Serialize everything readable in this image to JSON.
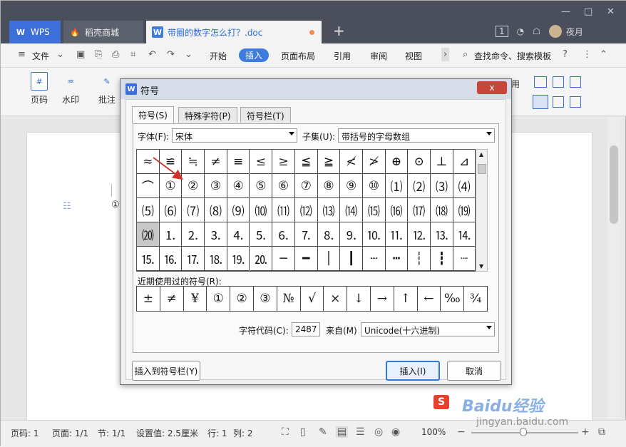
{
  "titlebar": {
    "tabs": [
      {
        "label": "WPS",
        "icon": "W"
      },
      {
        "label": "稻壳商城",
        "icon": "shell-icon"
      },
      {
        "label": "带圈的数字怎么打？.doc",
        "icon": "W"
      }
    ],
    "page_badge": "1",
    "user_name": "夜月"
  },
  "menubar": {
    "file_label": "文件",
    "items": [
      "开始",
      "插入",
      "页面布局",
      "引用",
      "审阅",
      "视图"
    ],
    "active_item": "插入",
    "search_label": "查找命令、搜索模板",
    "help_label": "?"
  },
  "ribbon": {
    "buttons": [
      "页码",
      "水印",
      "批注"
    ],
    "right_label": "用"
  },
  "dialog": {
    "title": "符号",
    "close_label": "x",
    "tabs": [
      "符号(S)",
      "特殊字符(P)",
      "符号栏(T)"
    ],
    "font_label": "字体(F):",
    "font_value": "宋体",
    "subset_label": "子集(U):",
    "subset_value": "带括号的字母数组",
    "symbols": [
      [
        "≈",
        "≌",
        "≒",
        "≠",
        "≡",
        "≤",
        "≥",
        "≦",
        "≧",
        "≮",
        "≯",
        "⊕",
        "⊙",
        "⊥",
        "⊿"
      ],
      [
        "⌒",
        "①",
        "②",
        "③",
        "④",
        "⑤",
        "⑥",
        "⑦",
        "⑧",
        "⑨",
        "⑩",
        "⑴",
        "⑵",
        "⑶",
        "⑷"
      ],
      [
        "⑸",
        "⑹",
        "⑺",
        "⑻",
        "⑼",
        "⑽",
        "⑾",
        "⑿",
        "⒀",
        "⒁",
        "⒂",
        "⒃",
        "⒄",
        "⒅",
        "⒆"
      ],
      [
        "⒇",
        "⒈",
        "⒉",
        "⒊",
        "⒋",
        "⒌",
        "⒍",
        "⒎",
        "⒏",
        "⒐",
        "⒑",
        "⒒",
        "⒓",
        "⒔",
        "⒕"
      ],
      [
        "⒖",
        "⒗",
        "⒘",
        "⒙",
        "⒚",
        "⒛",
        "─",
        "━",
        "│",
        "┃",
        "┄",
        "┅",
        "┆",
        "┇",
        "┈"
      ]
    ],
    "highlighted_symbol": "⒇",
    "recent_label": "近期使用过的符号(R):",
    "recent_symbols": [
      "±",
      "≠",
      "¥",
      "①",
      "②",
      "③",
      "№",
      "√",
      "×",
      "↓",
      "→",
      "↑",
      "←",
      "‰",
      "¾"
    ],
    "char_code_label": "字符代码(C):",
    "char_code_value": "2487",
    "from_label": "来自(M)",
    "from_value": "Unicode(十六进制)",
    "insert_to_bar_label": "插入到符号栏(Y)",
    "insert_label": "插入(I)",
    "cancel_label": "取消"
  },
  "document": {
    "inserted_text": "①"
  },
  "statusbar": {
    "page_num": "页码: 1",
    "pages": "页面: 1/1",
    "section": "节: 1/1",
    "setting": "设置值: 2.5厘米",
    "row": "行: 1",
    "col": "列: 2",
    "zoom": "100%"
  },
  "watermark": {
    "text": "Baidu经验",
    "url": "jingyan.baidu.com"
  },
  "colors": {
    "accent": "#3d7be0",
    "titlebar": "#4a4f5b",
    "annotation_arrow": "#d0302c"
  }
}
